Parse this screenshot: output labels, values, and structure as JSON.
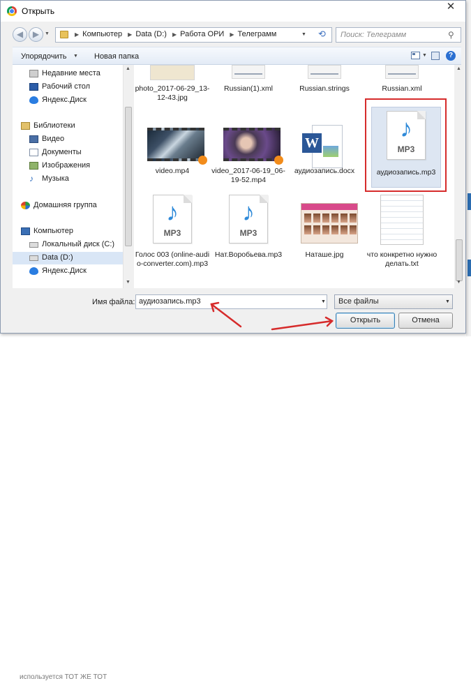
{
  "window": {
    "title": "Открыть",
    "close_glyph": "✕"
  },
  "address": {
    "crumbs": [
      "Компьютер",
      "Data (D:)",
      "Работа ОРИ",
      "Телеграмм"
    ],
    "search_placeholder": "Поиск: Телеграмм"
  },
  "toolbar": {
    "organize": "Упорядочить",
    "new_folder": "Новая папка",
    "help": "?"
  },
  "nav": {
    "recent": "Недавние места",
    "desktop": "Рабочий стол",
    "yadisk1": "Яндекс.Диск",
    "libraries": "Библиотеки",
    "video": "Видео",
    "documents": "Документы",
    "images": "Изображения",
    "music": "Музыка",
    "homegroup": "Домашняя группа",
    "computer": "Компьютер",
    "local_c": "Локальный диск (C:)",
    "data_d": "Data (D:)",
    "yadisk2": "Яндекс.Диск"
  },
  "files": {
    "photo": "photo_2017-06-29_13-12-43.jpg",
    "russian1": "Russian(1).xml",
    "russian_strings": "Russian.strings",
    "russian": "Russian.xml",
    "video": "video.mp4",
    "video2": "video_2017-06-19_06-19-52.mp4",
    "docx": "аудиозапись.docx",
    "mp3_sel": "аудиозапись.mp3",
    "golos": "Голос 003 (online-audio-converter.com).mp3",
    "nat": "Нат.Воробьева.mp3",
    "natashe": "Наташе.jpg",
    "txt": "что конкретно нужно делать.txt"
  },
  "icons": {
    "mp3_label": "MP3",
    "note_glyph": "♪",
    "word_glyph": "W"
  },
  "bottom": {
    "filename_label": "Имя файла:",
    "filename_value": "аудиозапись.mp3",
    "filetype_value": "Все файлы",
    "open": "Открыть",
    "cancel": "Отмена"
  },
  "background": {
    "bottom_text": "используется ТОТ ЖЕ ТОТ"
  },
  "colors": {
    "highlight_box": "#d62b2b",
    "arrow": "#d62b2b",
    "selection": "#dde6f2"
  }
}
